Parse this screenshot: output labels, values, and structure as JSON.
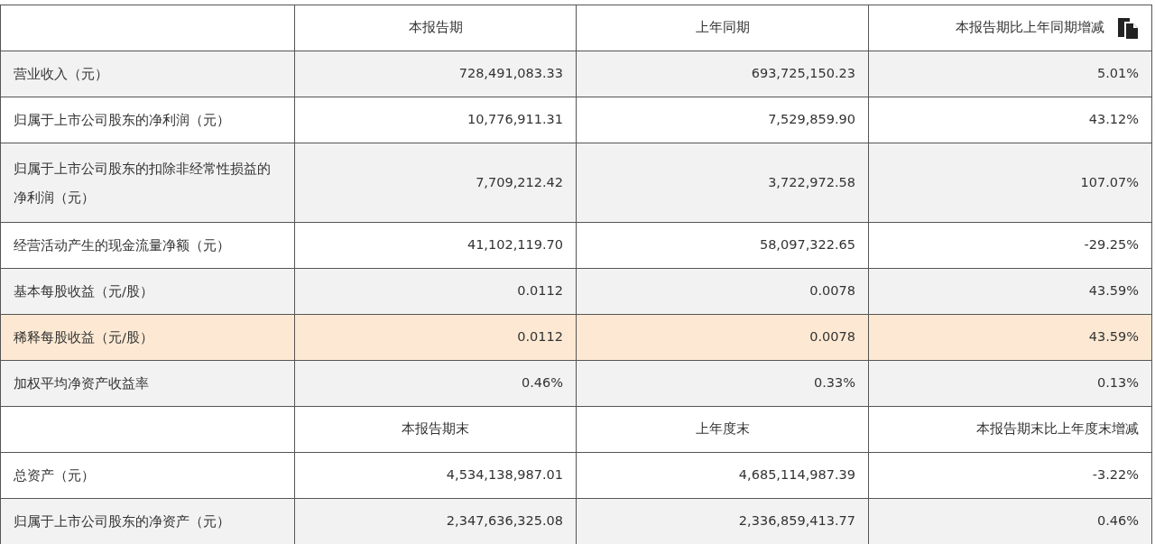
{
  "table": {
    "rows": [
      {
        "kind": "header",
        "cells": [
          "",
          "本报告期",
          "上年同期",
          "本报告期比上年同期增减"
        ],
        "copy_icon": true
      },
      {
        "kind": "data",
        "highlighted": false,
        "cells": [
          "营业收入（元）",
          "728,491,083.33",
          "693,725,150.23",
          "5.01%"
        ]
      },
      {
        "kind": "data",
        "highlighted": false,
        "cells": [
          "归属于上市公司股东的净利润（元）",
          "10,776,911.31",
          "7,529,859.90",
          "43.12%"
        ]
      },
      {
        "kind": "data",
        "highlighted": false,
        "cells": [
          "归属于上市公司股东的扣除非经常性损益的净利润（元）",
          "7,709,212.42",
          "3,722,972.58",
          "107.07%"
        ]
      },
      {
        "kind": "data",
        "highlighted": false,
        "cells": [
          "经营活动产生的现金流量净额（元）",
          "41,102,119.70",
          "58,097,322.65",
          "-29.25%"
        ]
      },
      {
        "kind": "data",
        "highlighted": false,
        "cells": [
          "基本每股收益（元/股）",
          "0.0112",
          "0.0078",
          "43.59%"
        ]
      },
      {
        "kind": "data",
        "highlighted": true,
        "cells": [
          "稀释每股收益（元/股）",
          "0.0112",
          "0.0078",
          "43.59%"
        ]
      },
      {
        "kind": "data",
        "highlighted": false,
        "cells": [
          "加权平均净资产收益率",
          "0.46%",
          "0.33%",
          "0.13%"
        ]
      },
      {
        "kind": "header",
        "cells": [
          "",
          "本报告期末",
          "上年度末",
          "本报告期末比上年度末增减"
        ],
        "copy_icon": false
      },
      {
        "kind": "data",
        "highlighted": false,
        "cells": [
          "总资产（元）",
          "4,534,138,987.01",
          "4,685,114,987.39",
          "-3.22%"
        ]
      },
      {
        "kind": "data",
        "highlighted": false,
        "cells": [
          "归属于上市公司股东的净资产（元）",
          "2,347,636,325.08",
          "2,336,859,413.77",
          "0.46%"
        ]
      }
    ]
  }
}
